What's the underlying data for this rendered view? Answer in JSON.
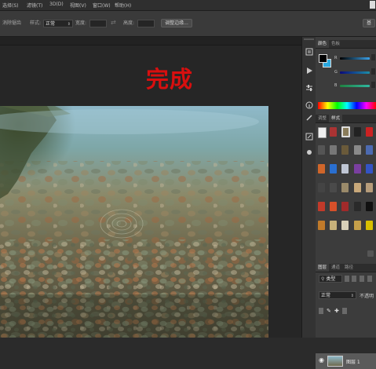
{
  "menu": {
    "items": [
      "选择(S)",
      "滤镜(T)",
      "3D(D)",
      "视图(V)",
      "窗口(W)",
      "帮助(H)"
    ]
  },
  "options": {
    "anti_alias_label": "消除锯齿",
    "style_label": "样式:",
    "style_value": "正常",
    "width_label": "宽度:",
    "height_label": "高度:",
    "refine_edge_label": "调整边缘...",
    "right_button_label": "基"
  },
  "canvas": {
    "title_text": "完成"
  },
  "panels": {
    "color_tabs": [
      "颜色",
      "色板"
    ],
    "color_channels": [
      "R",
      "G",
      "B"
    ],
    "style_tabs": [
      "调整",
      "样式"
    ],
    "layers_tabs": [
      "图层",
      "通道",
      "路径"
    ],
    "layers_kind": "类型",
    "blend_mode": "正常",
    "opacity_label": "不透明",
    "layer_name": "图层 1",
    "colors": {
      "foreground": "#000000",
      "background": "#29a8e0",
      "slider_red": "#3aa0e8",
      "slider_green": "#1c8ea8",
      "slider_blue": "#2fb7a0"
    }
  }
}
